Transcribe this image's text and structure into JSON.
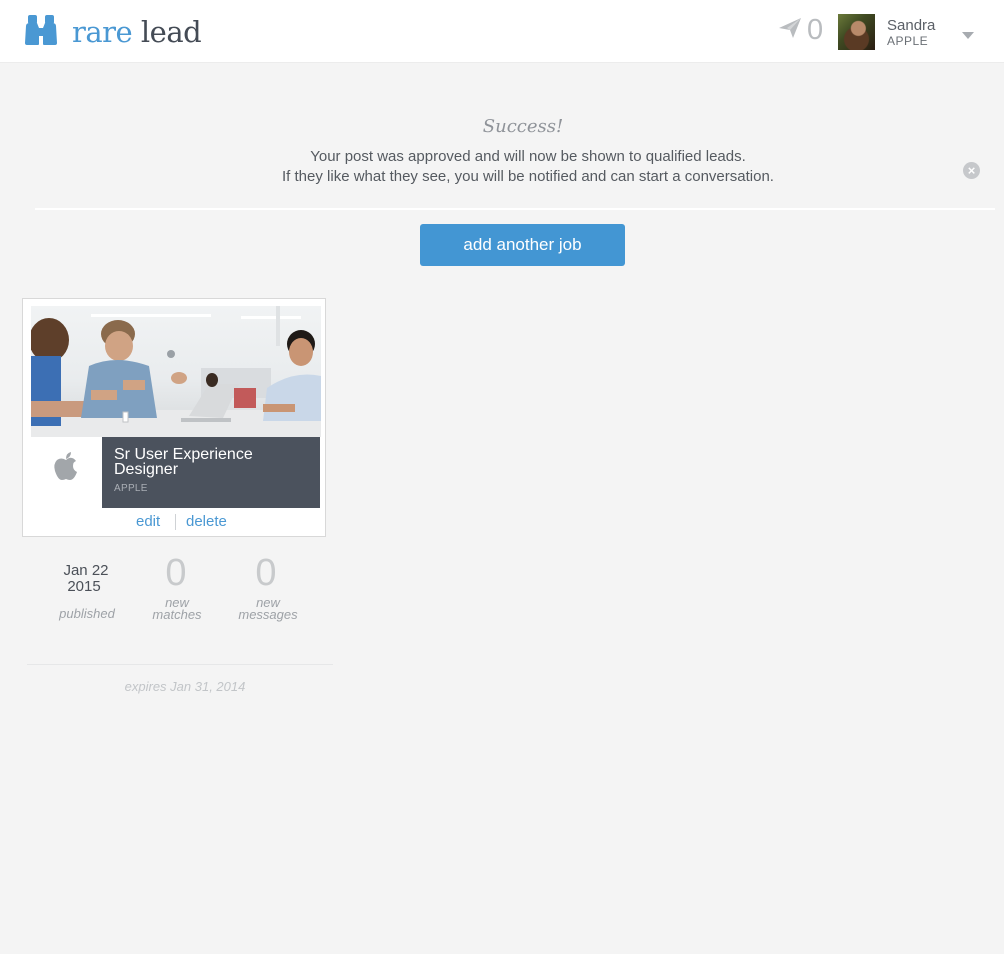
{
  "header": {
    "logo_word1": "rare",
    "logo_word2": "lead",
    "logo_icon": "binoculars-icon",
    "notification_icon": "paper-plane-icon",
    "notification_count": "0",
    "user_name": "Sandra",
    "user_company": "APPLE",
    "dropdown_icon": "caret-down-icon"
  },
  "alert": {
    "title": "Success!",
    "line1": "Your post was approved and will now be shown to qualified leads.",
    "line2": "If they like what they see, you will be notified and can start a conversation.",
    "close_icon": "close-circle-icon"
  },
  "actions": {
    "add_job_label": "add another job"
  },
  "job": {
    "title": "Sr User Experience Designer",
    "company": "APPLE",
    "company_logo": "apple-logo-icon",
    "edit_label": "edit",
    "delete_label": "delete",
    "published_month_day": "Jan 22",
    "published_year": "2015",
    "published_label": "published",
    "new_matches_count": "0",
    "new_matches_label_1": "new",
    "new_matches_label_2": "matches",
    "new_messages_count": "0",
    "new_messages_label_1": "new",
    "new_messages_label_2": "messages",
    "expires_text": "expires Jan 31, 2014"
  },
  "colors": {
    "accent": "#4396d3",
    "title_box": "#4b525d",
    "background": "#f4f4f4"
  }
}
